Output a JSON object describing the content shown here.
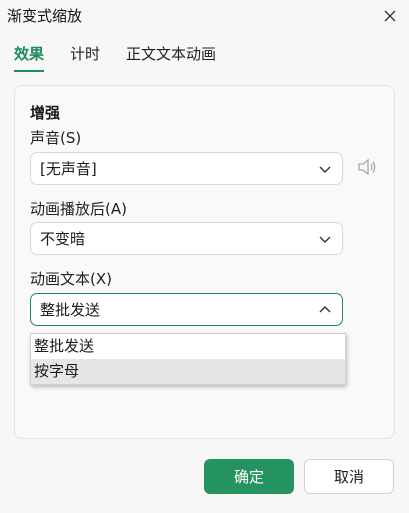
{
  "dialog": {
    "title": "渐变式缩放"
  },
  "tabs": [
    {
      "label": "效果",
      "active": true
    },
    {
      "label": "计时",
      "active": false
    },
    {
      "label": "正文文本动画",
      "active": false
    }
  ],
  "section": {
    "title": "增强"
  },
  "sound": {
    "label": "声音(S)",
    "value": "[无声音]"
  },
  "after_animation": {
    "label": "动画播放后(A)",
    "value": "不变暗"
  },
  "animate_text": {
    "label": "动画文本(X)",
    "value": "整批发送",
    "options": [
      "整批发送",
      "按字母"
    ],
    "hover_option": "按字母"
  },
  "buttons": {
    "ok": "确定",
    "cancel": "取消"
  },
  "colors": {
    "accent": "#1f8a5d",
    "primary_button": "#25935f"
  },
  "icons": {
    "close": "close-icon",
    "chevron": "chevron-down-icon",
    "chevron_up": "chevron-up-icon",
    "speaker": "speaker-icon"
  }
}
